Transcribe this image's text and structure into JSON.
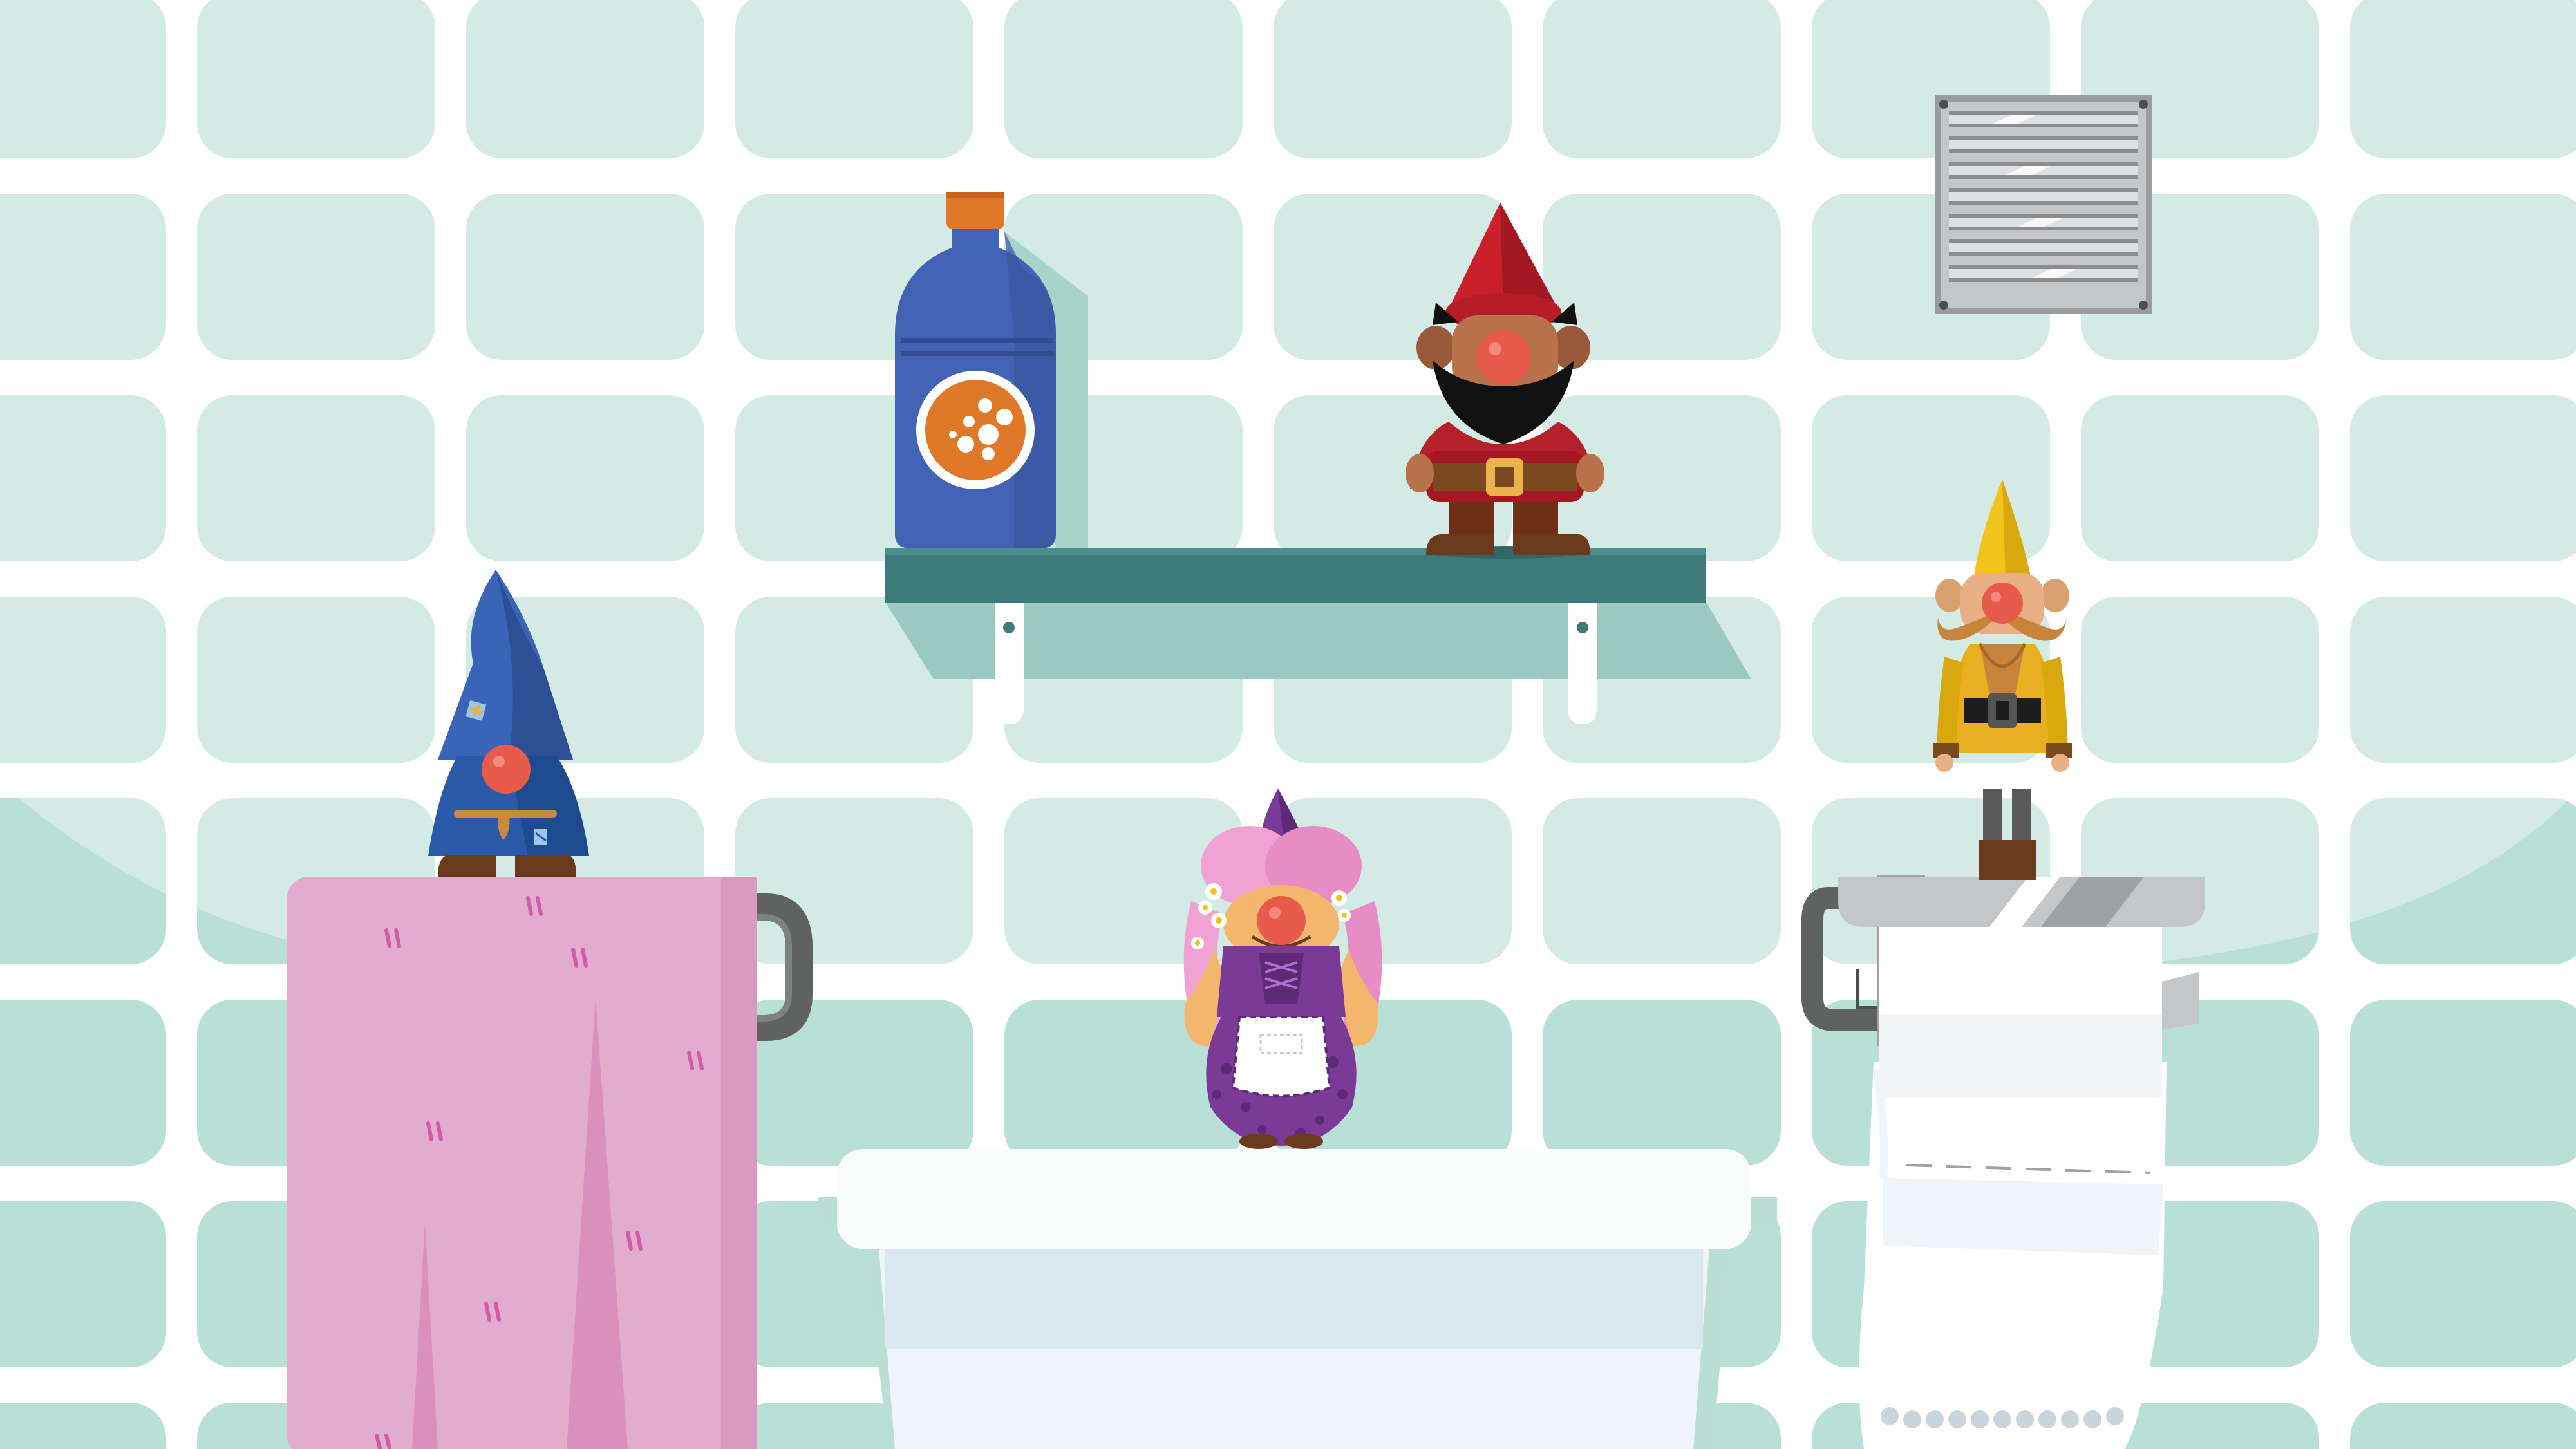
{
  "scene": {
    "type": "bathroom-gnome-puzzle",
    "background": "tiled-wall",
    "colors": {
      "tile": "#d3ebe4",
      "tile_shadow": "#a8d8cc",
      "grout": "#ffffff",
      "shelf": "#3d7b7b",
      "towel": "#e2acce",
      "sink": "#fafcfc",
      "paper": "#ffffff"
    }
  },
  "objects": [
    {
      "name": "vent-grille",
      "icon": "vent-icon"
    },
    {
      "name": "blue-bottle",
      "icon": "bottle-icon",
      "color": "#4263b5",
      "cap_color": "#e0782a"
    },
    {
      "name": "wall-shelf",
      "icon": "shelf-icon"
    },
    {
      "name": "towel-on-rail",
      "icon": "towel-icon"
    },
    {
      "name": "sink",
      "icon": "sink-icon"
    },
    {
      "name": "toilet-paper-roll",
      "icon": "paper-roll-icon"
    }
  ],
  "gnomes": [
    {
      "name": "red-gnome",
      "hat_color": "#c9202b",
      "location": "shelf"
    },
    {
      "name": "blue-gnome",
      "hat_color": "#3a64b8",
      "location": "towel"
    },
    {
      "name": "purple-gnome",
      "hat_color": "#7a3a96",
      "location": "sink"
    },
    {
      "name": "yellow-gnome",
      "hat_color": "#f2c31a",
      "location": "paper-holder"
    }
  ]
}
